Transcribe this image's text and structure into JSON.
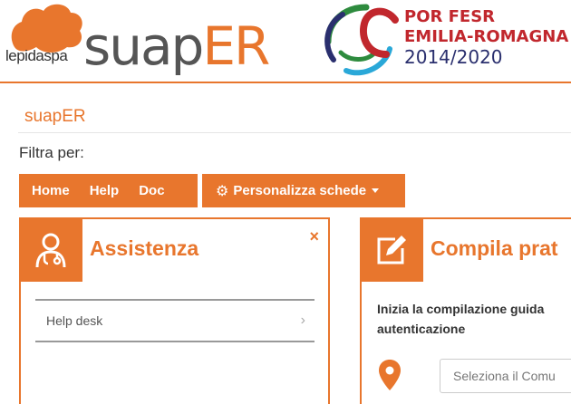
{
  "header": {
    "lepida_brand": "lepida",
    "lepida_suffix": "spa",
    "logo_main": "suap",
    "logo_accent": "ER",
    "fesr_line1": "POR FESR",
    "fesr_line2": "EMILIA-ROMAGNA",
    "fesr_years": "2014/2020"
  },
  "page": {
    "title": "suapER",
    "filter_label": "Filtra per:"
  },
  "nav": {
    "items": [
      {
        "label": "Home"
      },
      {
        "label": "Help"
      },
      {
        "label": "Doc"
      }
    ],
    "customize_label": "Personalizza schede"
  },
  "cards": {
    "assistenza": {
      "title": "Assistenza",
      "close": "×",
      "items": [
        {
          "label": "Help desk"
        }
      ]
    },
    "compila": {
      "title": "Compila prat",
      "description_line1": "Inizia la compilazione guida",
      "description_line2": "autenticazione",
      "select_placeholder": "Seleziona il Comu"
    }
  },
  "colors": {
    "accent": "#e8762d",
    "fesr_red": "#c1272d",
    "fesr_blue": "#2a2f6e",
    "fesr_green": "#2e8b3e"
  },
  "icons": {
    "assistenza": "doctor-icon",
    "compila": "edit-icon",
    "location": "map-pin-icon"
  }
}
